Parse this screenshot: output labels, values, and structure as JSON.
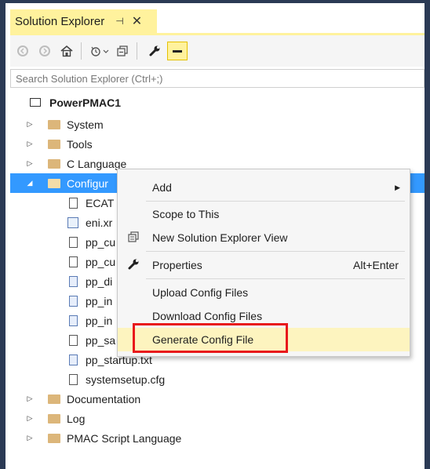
{
  "window": {
    "title": "Solution Explorer",
    "pin_glyph": "⊣",
    "close_glyph": "✕"
  },
  "toolbar": {
    "back_icon": "back-icon",
    "forward_icon": "forward-icon",
    "home_icon": "home-icon",
    "history_icon": "history-icon",
    "collapse_icon": "collapse-all-icon",
    "properties_icon": "wrench-icon",
    "preview_icon": "preview-icon"
  },
  "search": {
    "placeholder": "Search Solution Explorer (Ctrl+;)"
  },
  "tree": {
    "project": "PowerPMAC1",
    "items": [
      {
        "label": "System"
      },
      {
        "label": "Tools"
      },
      {
        "label": "C Language"
      },
      {
        "label": "Configur"
      },
      {
        "label": "ECAT"
      },
      {
        "label": "eni.xr"
      },
      {
        "label": "pp_cu"
      },
      {
        "label": "pp_cu"
      },
      {
        "label": "pp_di"
      },
      {
        "label": "pp_in"
      },
      {
        "label": "pp_in"
      },
      {
        "label": "pp_sa"
      },
      {
        "label": "pp_startup.txt"
      },
      {
        "label": "systemsetup.cfg"
      },
      {
        "label": "Documentation"
      },
      {
        "label": "Log"
      },
      {
        "label": "PMAC Script Language"
      }
    ]
  },
  "context_menu": {
    "add": "Add",
    "scope": "Scope to This",
    "new_view": "New Solution Explorer View",
    "properties": "Properties",
    "properties_shortcut": "Alt+Enter",
    "upload": "Upload Config Files",
    "download": "Download Config Files",
    "generate": "Generate Config File"
  },
  "colors": {
    "accent_yellow": "#fff29d",
    "selection_blue": "#3399ff",
    "highlight_red": "#e8181b",
    "frame_navy": "#2b3a55"
  }
}
